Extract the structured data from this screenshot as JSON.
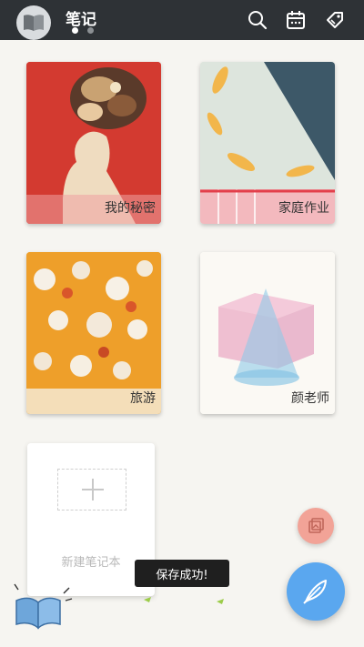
{
  "header": {
    "title": "笔记",
    "page_indicator": {
      "current": 1,
      "total": 2
    },
    "icons": [
      "search-icon",
      "calendar-icon",
      "tag-icon"
    ]
  },
  "notebooks": [
    {
      "label": "我的秘密"
    },
    {
      "label": "家庭作业"
    },
    {
      "label": "旅游"
    },
    {
      "label": "颜老师"
    }
  ],
  "new_notebook": {
    "label": "新建笔记本"
  },
  "toast": {
    "text": "保存成功!"
  },
  "colors": {
    "topbar": "#2e3236",
    "background": "#f6f5f1",
    "fab": "#5aa7ef",
    "fab_small": "#f2a397"
  }
}
